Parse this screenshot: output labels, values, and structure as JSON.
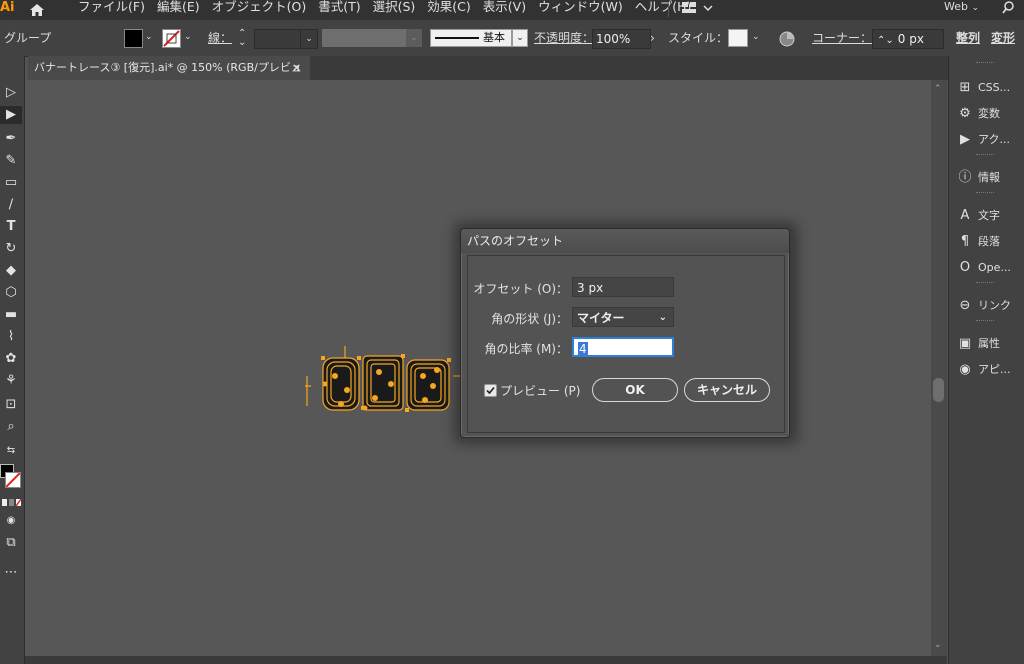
{
  "app": {
    "logo": "Ai"
  },
  "menu": [
    "ファイル(F)",
    "編集(E)",
    "オブジェクト(O)",
    "書式(T)",
    "選択(S)",
    "効果(C)",
    "表示(V)",
    "ウィンドウ(W)",
    "ヘルプ(H)"
  ],
  "menu_right": {
    "workspace": "Web"
  },
  "control": {
    "group_label": "グループ",
    "stroke_label": "線：",
    "stroke_style": "基本",
    "opacity_label": "不透明度：",
    "opacity_value": "100%",
    "style_label": "スタイル：",
    "corner_label": "コーナー：",
    "corner_value": "0 px",
    "align_label": "整列",
    "transform_label": "変形"
  },
  "document_tab": {
    "title": "バナートレース③ [復元].ai* @ 150% (RGB/プレビュー)",
    "close": "×"
  },
  "right_panel": [
    {
      "icon": "css-icon",
      "glyph": "⊞",
      "label": "CSS..."
    },
    {
      "icon": "variables-icon",
      "glyph": "⚙",
      "label": "変数"
    },
    {
      "icon": "actions-icon",
      "glyph": "▶",
      "label": "アク..."
    },
    {
      "icon": "info-icon",
      "glyph": "ⓘ",
      "label": "情報"
    },
    {
      "icon": "character-icon",
      "glyph": "A",
      "label": "文字"
    },
    {
      "icon": "paragraph-icon",
      "glyph": "¶",
      "label": "段落"
    },
    {
      "icon": "opentype-icon",
      "glyph": "O",
      "label": "Ope..."
    },
    {
      "icon": "links-icon",
      "glyph": "⊖",
      "label": "リンク"
    },
    {
      "icon": "attributes-icon",
      "glyph": "▣",
      "label": "属性"
    },
    {
      "icon": "appearance-icon",
      "glyph": "◉",
      "label": "アピ..."
    }
  ],
  "dialog": {
    "title": "パスのオフセット",
    "offset_label": "オフセット (O)：",
    "offset_value": "3 px",
    "join_label": "角の形状 (J)：",
    "join_value": "マイター",
    "miter_label": "角の比率 (M)：",
    "miter_value": "4",
    "preview_label": "プレビュー (P)",
    "preview_checked": true,
    "ok_label": "OK",
    "cancel_label": "キャンセル"
  },
  "colors": {
    "accent": "#ff9a00",
    "selection": "#f5a623",
    "focus": "#2e7fd6"
  }
}
